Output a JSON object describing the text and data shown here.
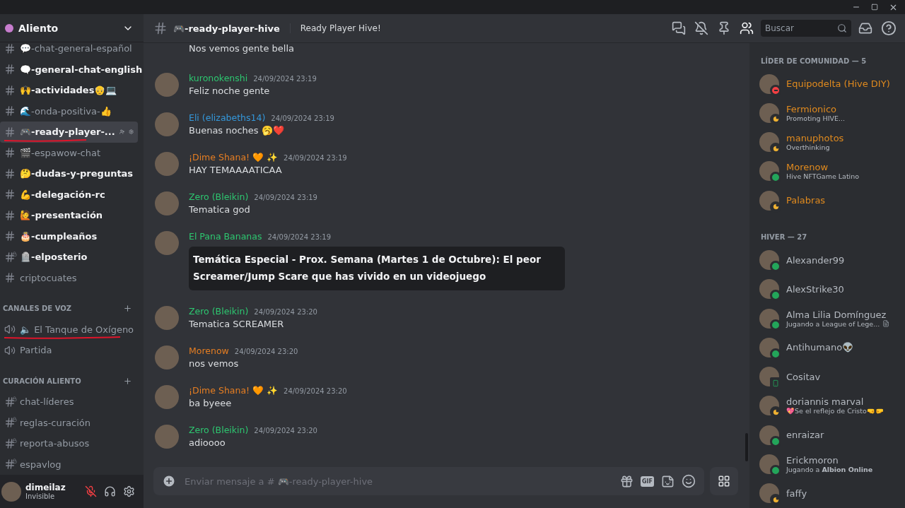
{
  "server": {
    "name": "Aliento"
  },
  "channels": [
    {
      "kind": "text",
      "name": "💬-chat-general-español",
      "unread": false,
      "selected": false,
      "locked": false,
      "underlined": false
    },
    {
      "kind": "text",
      "name": "🗨️-general-chat-english",
      "unread": true,
      "selected": false,
      "locked": false,
      "underlined": false
    },
    {
      "kind": "text",
      "name": "🙌-actividades👴💻",
      "unread": true,
      "selected": false,
      "locked": false,
      "underlined": false
    },
    {
      "kind": "text",
      "name": "🌊-onda-positiva-👍",
      "unread": false,
      "selected": false,
      "locked": false,
      "underlined": false
    },
    {
      "kind": "text",
      "name": "🎮-ready-player-...",
      "unread": true,
      "selected": true,
      "locked": false,
      "underlined": true
    },
    {
      "kind": "text",
      "name": "🎬-espawow-chat",
      "unread": false,
      "selected": false,
      "locked": false,
      "underlined": false
    },
    {
      "kind": "text",
      "name": "🤔-dudas-y-preguntas",
      "unread": true,
      "selected": false,
      "locked": false,
      "underlined": false
    },
    {
      "kind": "text",
      "name": "💪-delegación-rc",
      "unread": true,
      "selected": false,
      "locked": false,
      "underlined": false
    },
    {
      "kind": "text",
      "name": "🙋-presentación",
      "unread": true,
      "selected": false,
      "locked": false,
      "underlined": false
    },
    {
      "kind": "text",
      "name": "🎂-cumpleaños",
      "unread": true,
      "selected": false,
      "locked": false,
      "underlined": false
    },
    {
      "kind": "text",
      "name": "🪦-elposterio",
      "unread": true,
      "selected": false,
      "locked": true,
      "underlined": false
    },
    {
      "kind": "text",
      "name": "criptocuates",
      "unread": false,
      "selected": false,
      "locked": false,
      "underlined": false
    },
    {
      "kind": "category",
      "name": "CANALES DE VOZ"
    },
    {
      "kind": "voice",
      "name": "🔈 El Tanque de Oxígeno",
      "unread": false,
      "selected": false,
      "locked": false,
      "underlined": true
    },
    {
      "kind": "voice",
      "name": "Partida",
      "unread": false,
      "selected": false,
      "locked": false,
      "underlined": false
    },
    {
      "kind": "category",
      "name": "CURACIÓN ALIENTO"
    },
    {
      "kind": "text",
      "name": "chat-líderes",
      "unread": false,
      "selected": false,
      "locked": true,
      "underlined": false
    },
    {
      "kind": "text",
      "name": "reglas-curación",
      "unread": false,
      "selected": false,
      "locked": true,
      "underlined": false
    },
    {
      "kind": "text",
      "name": "reporta-abusos",
      "unread": false,
      "selected": false,
      "locked": true,
      "underlined": false
    },
    {
      "kind": "text",
      "name": "espavlog",
      "unread": false,
      "selected": false,
      "locked": true,
      "underlined": false
    }
  ],
  "user": {
    "name": "dimeilaz",
    "status": "Invisible",
    "muted": true
  },
  "header": {
    "channel": "🎮-ready-player-hive",
    "topic": "Ready Player Hive!",
    "search_placeholder": "Buscar"
  },
  "messages": [
    {
      "kind": "continuation",
      "text": "Nos vemos gente bella"
    },
    {
      "kind": "text",
      "author": "kuronokenshi",
      "color": "#2dc770",
      "time": "24/09/2024 23:19",
      "text": "Feliz noche gente"
    },
    {
      "kind": "text",
      "author": "Eli (elizabeths14)",
      "color": "#3498db",
      "time": "24/09/2024 23:19",
      "text": "Buenas noches 🥱❤️"
    },
    {
      "kind": "text",
      "author": "¡Dime Shana! 🧡 ✨",
      "color": "#e67e22",
      "time": "24/09/2024 23:19",
      "text": "HAY TEMAAAATICAA"
    },
    {
      "kind": "text",
      "author": "Zero (Bleikin)",
      "color": "#2dc770",
      "time": "24/09/2024 23:19",
      "text": "Tematica god"
    },
    {
      "kind": "embed",
      "author": "El Pana Bananas",
      "color": "#2dc770",
      "time": "24/09/2024 23:19",
      "text": "Temática Especial - Prox. Semana (Martes 1 de Octubre): El peor Screamer/Jump Scare que has vivido en un videojuego"
    },
    {
      "kind": "text",
      "author": "Zero (Bleikin)",
      "color": "#2dc770",
      "time": "24/09/2024 23:20",
      "text": "Tematica SCREAMER"
    },
    {
      "kind": "text",
      "author": "Morenow",
      "color": "#e67e22",
      "time": "24/09/2024 23:20",
      "text": "nos vemos"
    },
    {
      "kind": "text",
      "author": "¡Dime Shana! 🧡 ✨",
      "color": "#e67e22",
      "time": "24/09/2024 23:20",
      "text": "ba byeee"
    },
    {
      "kind": "text",
      "author": "Zero (Bleikin)",
      "color": "#2dc770",
      "time": "24/09/2024 23:20",
      "text": "adioooo"
    }
  ],
  "composer": {
    "placeholder": "Enviar mensaje a # 🎮-ready-player-hive",
    "gif_label": "GIF"
  },
  "member_groups": [
    {
      "title": "LÍDER DE COMUNIDAD — 5",
      "color": "#e08a1e",
      "members": [
        {
          "name": "Equipodelta (Hive DIY)",
          "kind": "dnd"
        },
        {
          "name": "Fermionico",
          "activity": "Promoting HIVE...",
          "kind": "idle"
        },
        {
          "name": "manuphotos",
          "activity": "Overthinking",
          "kind": "idle"
        },
        {
          "name": "Morenow",
          "activity": "Hive NFTGame Latino",
          "kind": "online"
        },
        {
          "name": "Palabras",
          "kind": "idle"
        }
      ]
    },
    {
      "title": "HIVER — 27",
      "color": "#b5bac1",
      "members": [
        {
          "name": "Alexander99",
          "kind": "online"
        },
        {
          "name": "AlexStrike30",
          "kind": "online"
        },
        {
          "name": "Alma Lilia Domínguez",
          "activity": "Jugando a League of Lege...",
          "rich_presence": true,
          "kind": "online"
        },
        {
          "name": "Antihumano👽",
          "kind": "online"
        },
        {
          "name": "Cositav",
          "kind": "mobile"
        },
        {
          "name": "doriannis marval",
          "activity": "💖Se el reflejo de Cristo🤜🤛",
          "kind": "idle"
        },
        {
          "name": "enraizar",
          "kind": "online"
        },
        {
          "name": "Erickmoron",
          "activity": "Jugando a **Albion Online**",
          "kind": "online"
        },
        {
          "name": "faffy",
          "kind": "idle"
        }
      ]
    }
  ]
}
